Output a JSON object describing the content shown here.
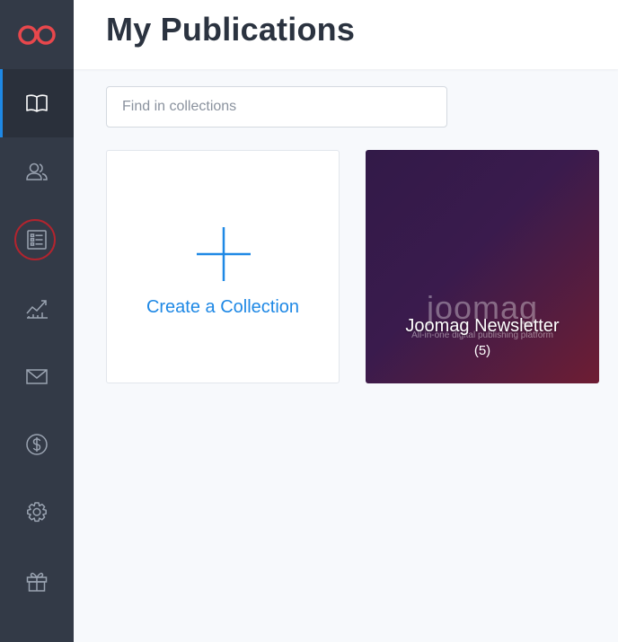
{
  "page": {
    "title": "My Publications"
  },
  "sidebar": {
    "logo_icon": "infinity-logo-icon",
    "items": [
      {
        "id": "publications",
        "icon": "book-icon",
        "active": true
      },
      {
        "id": "subscribers",
        "icon": "users-icon",
        "active": false
      },
      {
        "id": "collections",
        "icon": "list-icon",
        "active": false,
        "highlighted": true
      },
      {
        "id": "analytics",
        "icon": "chart-icon",
        "active": false
      },
      {
        "id": "email",
        "icon": "mail-icon",
        "active": false
      },
      {
        "id": "sales",
        "icon": "dollar-icon",
        "active": false
      },
      {
        "id": "settings",
        "icon": "gear-icon",
        "active": false
      },
      {
        "id": "gift",
        "icon": "gift-icon",
        "active": false
      }
    ]
  },
  "search": {
    "placeholder": "Find in collections",
    "value": ""
  },
  "create_card": {
    "label": "Create a Collection",
    "icon": "plus-icon"
  },
  "collections": [
    {
      "name": "Joomag Newsletter",
      "count": "(5)",
      "cover_logo": "joomag",
      "cover_tagline": "All-in-one digital publishing platform"
    }
  ],
  "colors": {
    "sidebar_bg": "#333a47",
    "active_accent": "#1e88e5",
    "highlight_ring": "#b3242e",
    "logo": "#e8474c"
  }
}
